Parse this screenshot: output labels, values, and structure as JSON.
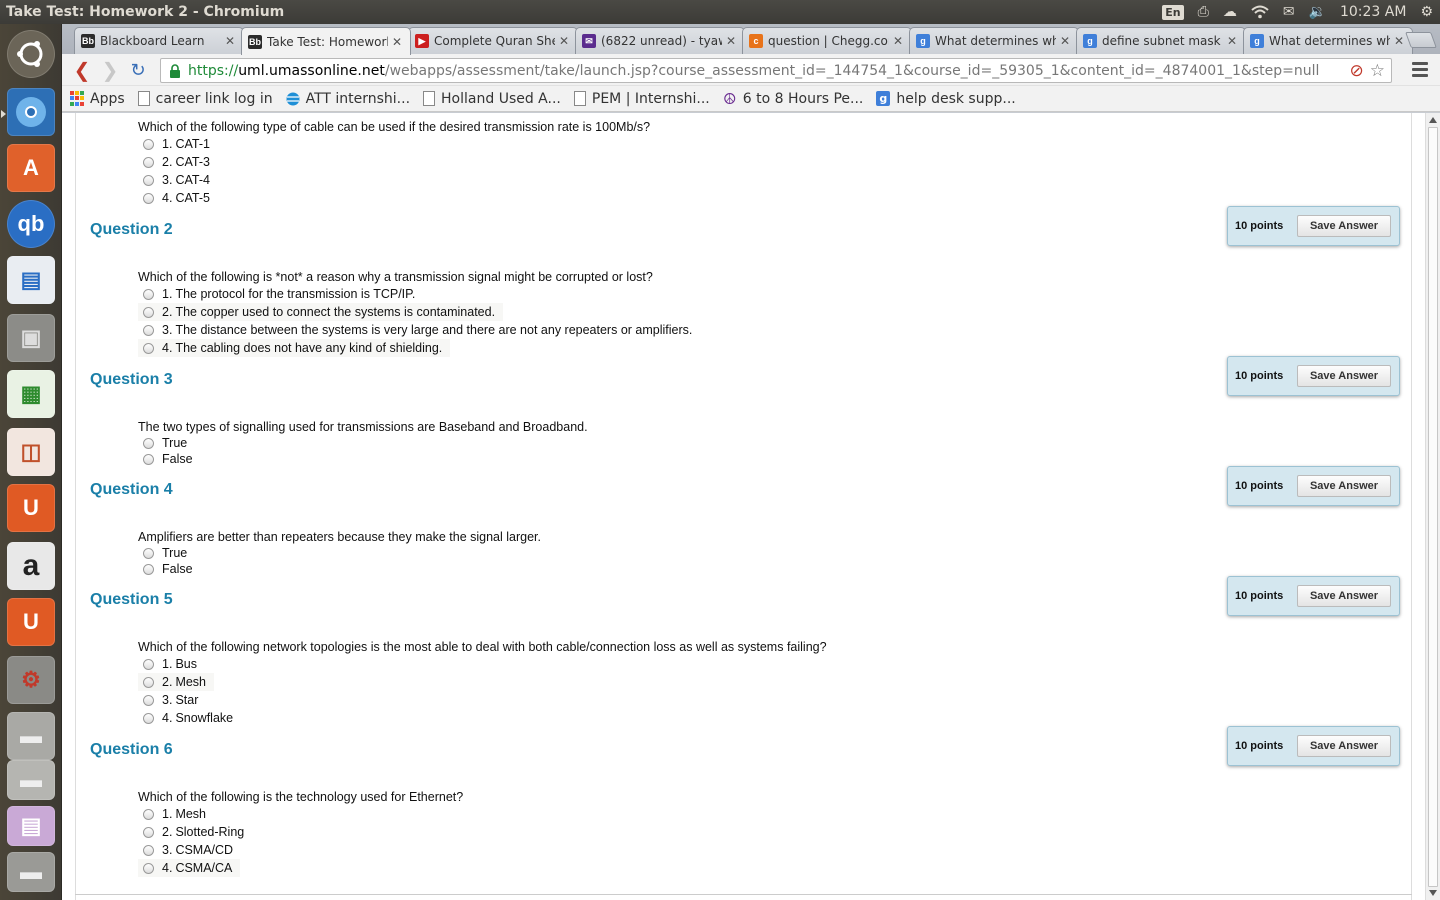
{
  "window": {
    "title": "Take Test: Homework 2 - Chromium"
  },
  "panel": {
    "input_indicator": "En",
    "clock": "10:23 AM"
  },
  "tabs": [
    {
      "label": "Blackboard Learn",
      "fav_text": "Bb",
      "fav_color": "#2b2b2b",
      "active": false
    },
    {
      "label": "Take Test: Homework",
      "fav_text": "Bb",
      "fav_color": "#2b2b2b",
      "active": true
    },
    {
      "label": "Complete Quran She",
      "fav_text": "▶",
      "fav_color": "#cc1f1f",
      "active": false
    },
    {
      "label": "(6822 unread) - tyaw",
      "fav_text": "✉",
      "fav_color": "#5b2c8e",
      "active": false
    },
    {
      "label": "question | Chegg.cor",
      "fav_text": "c",
      "fav_color": "#e8731a",
      "active": false
    },
    {
      "label": "What determines wh",
      "fav_text": "g",
      "fav_color": "#3f7fd9",
      "active": false
    },
    {
      "label": "define subnet mask -",
      "fav_text": "g",
      "fav_color": "#3f7fd9",
      "active": false
    },
    {
      "label": "What determines wh",
      "fav_text": "g",
      "fav_color": "#3f7fd9",
      "active": false
    }
  ],
  "address": {
    "scheme": "https://",
    "host": "uml.umassonline.net",
    "path": "/webapps/assessment/take/launch.jsp?course_assessment_id=_144754_1&course_id=_59305_1&content_id=_4874001_1&step=null"
  },
  "bookmarks": [
    {
      "label": "Apps",
      "icon": "apps-grid-icon"
    },
    {
      "label": "career link log in",
      "icon": "page-icon"
    },
    {
      "label": "ATT internshi...",
      "icon": "att-globe-icon"
    },
    {
      "label": "Holland Used A...",
      "icon": "page-icon"
    },
    {
      "label": "PEM | Internshi...",
      "icon": "page-icon"
    },
    {
      "label": "6 to 8 Hours Pe...",
      "icon": "peace-icon"
    },
    {
      "label": "help desk supp...",
      "icon": "google-g-icon"
    }
  ],
  "colors": {
    "question_title": "#1a7fa8",
    "points_box": "#d4e7ef",
    "url_scheme": "#1e8a38"
  },
  "questions": [
    {
      "title": "",
      "points": "",
      "text": "Which of the following type of cable can be used if the desired transmission rate is 100Mb/s?",
      "options": [
        {
          "num": "1.",
          "label": "CAT-1"
        },
        {
          "num": "2.",
          "label": "CAT-3"
        },
        {
          "num": "3.",
          "label": "CAT-4"
        },
        {
          "num": "4.",
          "label": "CAT-5"
        }
      ]
    },
    {
      "title": "Question 2",
      "points": "10 points",
      "text": "Which of the following is *not* a reason why a transmission signal might be corrupted or lost?",
      "options": [
        {
          "num": "1.",
          "label": "The protocol for the transmission is TCP/IP."
        },
        {
          "num": "2.",
          "label": "The copper used to connect the systems is contaminated."
        },
        {
          "num": "3.",
          "label": "The distance between the systems is very large and there are not any repeaters or amplifiers."
        },
        {
          "num": "4.",
          "label": "The cabling does not have any kind of shielding."
        }
      ]
    },
    {
      "title": "Question 3",
      "points": "10 points",
      "text": "The two types of signalling used for transmissions are Baseband and Broadband.",
      "options": [
        {
          "num": "",
          "label": "True"
        },
        {
          "num": "",
          "label": "False"
        }
      ]
    },
    {
      "title": "Question 4",
      "points": "10 points",
      "text": "Amplifiers are better than repeaters because they make the signal larger.",
      "options": [
        {
          "num": "",
          "label": "True"
        },
        {
          "num": "",
          "label": "False"
        }
      ]
    },
    {
      "title": "Question 5",
      "points": "10 points",
      "text": "Which of the following network topologies is the most able to deal with both cable/connection loss as well as systems failing?",
      "options": [
        {
          "num": "1.",
          "label": "Bus"
        },
        {
          "num": "2.",
          "label": "Mesh"
        },
        {
          "num": "3.",
          "label": "Star"
        },
        {
          "num": "4.",
          "label": "Snowflake"
        }
      ]
    },
    {
      "title": "Question 6",
      "points": "10 points",
      "text": "Which of the following is the technology used for Ethernet?",
      "options": [
        {
          "num": "1.",
          "label": "Mesh"
        },
        {
          "num": "2.",
          "label": "Slotted-Ring"
        },
        {
          "num": "3.",
          "label": "CSMA/CD"
        },
        {
          "num": "4.",
          "label": "CSMA/CA"
        }
      ]
    }
  ],
  "save_label": "Save Answer"
}
